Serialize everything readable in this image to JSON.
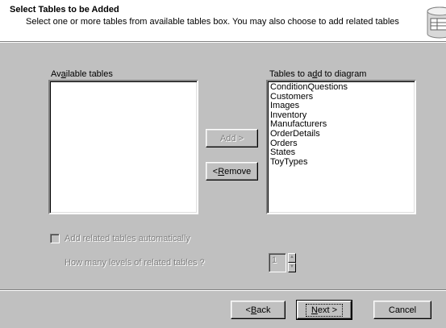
{
  "header": {
    "title": "Select Tables to be Added",
    "subtitle": "Select one or more tables from available tables box. You may also choose to add related tables",
    "icon": "database-icon"
  },
  "available": {
    "label_pre": "Av",
    "label_u": "a",
    "label_post": "ilable tables",
    "items": []
  },
  "selected": {
    "label_pre": "Tables to a",
    "label_u": "d",
    "label_post": "d to diagram",
    "items": [
      "ConditionQuestions",
      "Customers",
      "Images",
      "Inventory",
      "Manufacturers",
      "OrderDetails",
      "Orders",
      "States",
      "ToyTypes"
    ]
  },
  "buttons": {
    "add": "Add >",
    "remove_pre": "< ",
    "remove_u": "R",
    "remove_post": "emove",
    "back_pre": "< ",
    "back_u": "B",
    "back_post": "ack",
    "next_u": "N",
    "next_post": "ext >",
    "cancel": "Cancel"
  },
  "related": {
    "checkbox_label": "Add related tables automatically",
    "levels_label": "How many levels of related tables ?",
    "levels_value": "1",
    "checked": false
  },
  "colors": {
    "face": "#c0c0c0",
    "shadow": "#808080",
    "highlight": "#ffffff",
    "window": "#ffffff"
  }
}
